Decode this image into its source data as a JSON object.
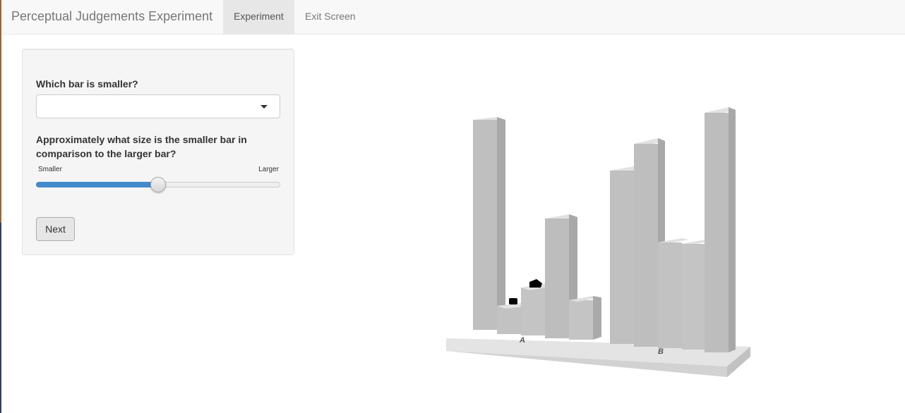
{
  "navbar": {
    "brand": "Perceptual Judgements Experiment",
    "tabs": [
      {
        "label": "Experiment",
        "active": true
      },
      {
        "label": "Exit Screen",
        "active": false
      }
    ]
  },
  "form": {
    "question1": "Which bar is smaller?",
    "select_value": "",
    "question2": "Approximately what size is the smaller bar in comparison to the larger bar?",
    "slider": {
      "min_label": "Smaller",
      "max_label": "Larger",
      "value": 0.5
    },
    "next_label": "Next"
  },
  "stimulus": {
    "group_labels": [
      "A",
      "B"
    ],
    "colors": {
      "front": "#c4c4c4",
      "side": "#a9a9a9",
      "top": "#e0e0e0",
      "base": "#d8d8d8",
      "marker": "#000000"
    }
  }
}
